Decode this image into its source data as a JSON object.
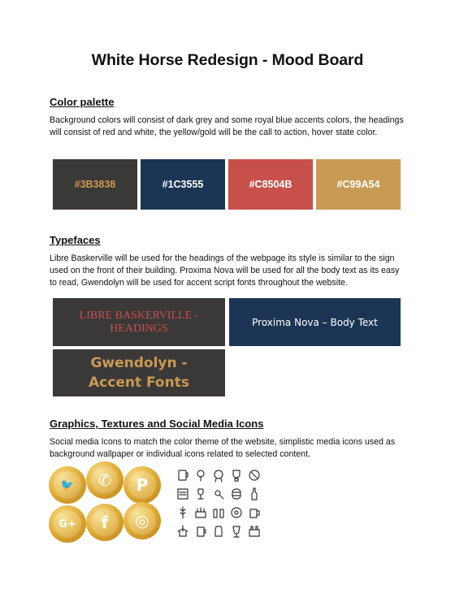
{
  "title": "White Horse Redesign - Mood Board",
  "color_palette": {
    "heading": "Color palette",
    "description": "Background colors will consist of dark grey and some royal blue accents colors, the headings will consist of red and white, the yellow/gold will be the call to action, hover state color.",
    "swatches": [
      {
        "hex": "#3B3838",
        "label_color": "#C99A54"
      },
      {
        "hex": "#1C3555",
        "label_color": "#FFFFFF"
      },
      {
        "hex": "#C8504B",
        "label_color": "#FFFFFF"
      },
      {
        "hex": "#C99A54",
        "label_color": "#FFFFFF"
      }
    ]
  },
  "typefaces": {
    "heading": "Typefaces",
    "description": "Libre Baskerville will be used for the headings of the webpage its style is similar to the sign used on the front of their building. Proxima Nova will be used for all the body text as its easy to read, Gwendolyn will be used for accent script fonts throughout the website.",
    "samples": [
      {
        "text": "LIBRE BASKERVILLE - HEADINGS",
        "bg": "#3B3838",
        "color": "#C8504B"
      },
      {
        "text": "Proxima Nova – Body Text",
        "bg": "#1C3555",
        "color": "#FFFFFF"
      },
      {
        "text": "Gwendolyn - Accent Fonts",
        "bg": "#3B3838",
        "color": "#C99A54"
      }
    ]
  },
  "graphics": {
    "heading": "Graphics, Textures and Social Media Icons",
    "description": "Social media Icons to match the color theme of the website, simplistic media icons used as background wallpaper or individual icons related to selected content.",
    "social_icons": [
      {
        "icon": "twitter-icon",
        "glyph": "🐦"
      },
      {
        "icon": "whatsapp-icon",
        "glyph": "✆"
      },
      {
        "icon": "pinterest-icon",
        "glyph": "P"
      },
      {
        "icon": "google-plus-icon",
        "glyph": "G+"
      },
      {
        "icon": "facebook-icon",
        "glyph": "f"
      },
      {
        "icon": "instagram-icon",
        "glyph": "◎"
      }
    ],
    "pub_icons": [
      "beer-glass-icon",
      "hops-icon",
      "badge-icon",
      "keg-icon",
      "no-drink-icon",
      "menu-board-icon",
      "trophy-icon",
      "bottle-opener-icon",
      "barrel-icon",
      "bottle-icon",
      "wheat-icon",
      "crate-icon",
      "bottles-icon",
      "tag-icon",
      "mug-icon",
      "windmill-icon",
      "beer-mug-icon",
      "jug-icon",
      "goblet-icon",
      "six-pack-icon"
    ]
  }
}
